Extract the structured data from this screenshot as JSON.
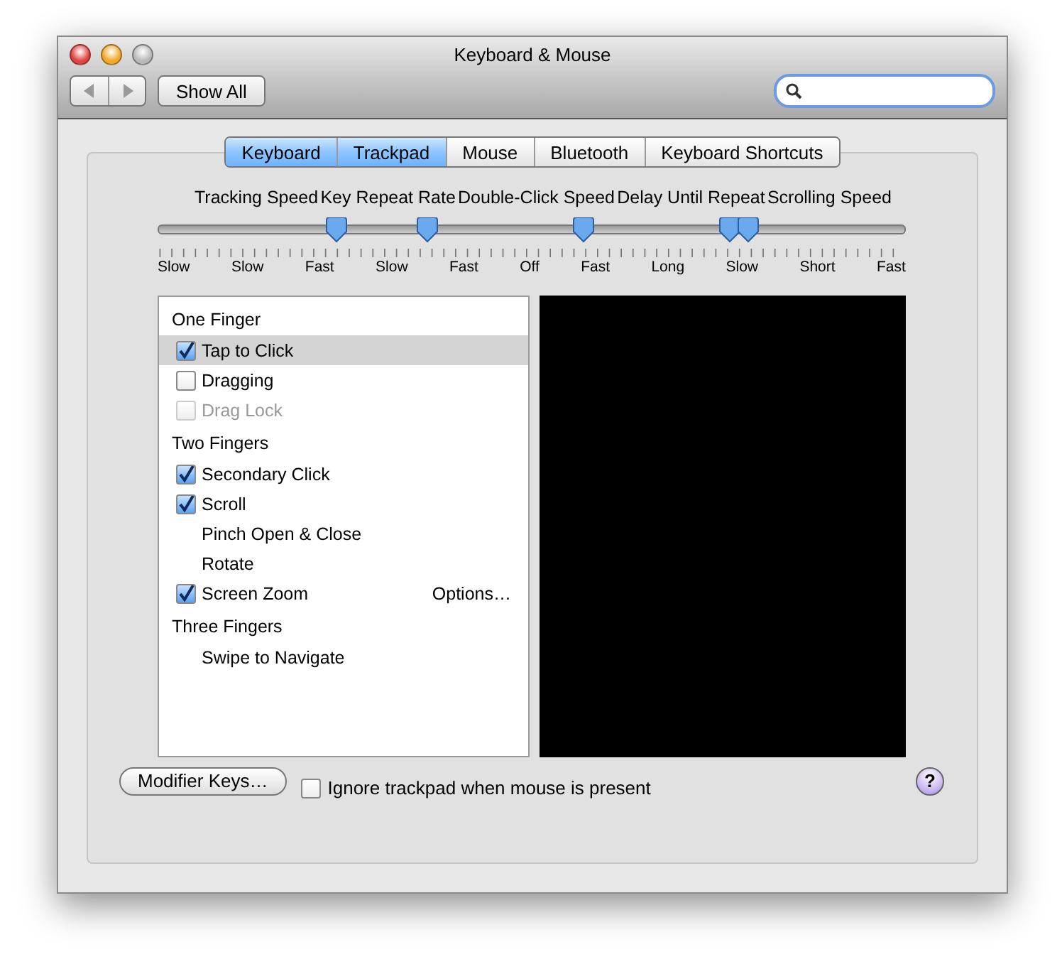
{
  "window": {
    "title": "Keyboard & Mouse"
  },
  "toolbar": {
    "show_all": "Show All"
  },
  "tabs": [
    {
      "label": "Keyboard",
      "selected": true
    },
    {
      "label": "Trackpad",
      "selected": true
    },
    {
      "label": "Mouse",
      "selected": false
    },
    {
      "label": "Bluetooth",
      "selected": false
    },
    {
      "label": "Keyboard Shortcuts",
      "selected": false
    }
  ],
  "sliders": {
    "headings": [
      "Tracking Speed",
      "Key Repeat Rate",
      "Double-Click Speed",
      "Delay Until Repeat",
      "Scrolling Speed"
    ],
    "thumbs": [
      {
        "level": 0.24
      },
      {
        "level": 0.36
      },
      {
        "level": 0.57
      },
      {
        "level": 0.765
      },
      {
        "level": 0.79
      }
    ],
    "tick_labels": [
      "Slow",
      "Slow",
      "Fast",
      "Slow",
      "Fast",
      "Off",
      "Fast",
      "Long",
      "Slow",
      "Short",
      "Fast"
    ]
  },
  "gesture_list": {
    "groups": [
      {
        "heading": "One Finger",
        "items": [
          {
            "label": "Tap to Click",
            "kind": "checkbox",
            "checked": true,
            "disabled": false,
            "selected": true
          },
          {
            "label": "Dragging",
            "kind": "checkbox",
            "checked": false,
            "disabled": false,
            "selected": false
          },
          {
            "label": "Drag Lock",
            "kind": "checkbox",
            "checked": false,
            "disabled": true,
            "selected": false
          }
        ]
      },
      {
        "heading": "Two Fingers",
        "items": [
          {
            "label": "Secondary Click",
            "kind": "checkbox",
            "checked": true,
            "disabled": false,
            "selected": false
          },
          {
            "label": "Scroll",
            "kind": "checkbox",
            "checked": true,
            "disabled": false,
            "selected": false
          },
          {
            "label": "Pinch Open & Close",
            "kind": "plain",
            "selected": false
          },
          {
            "label": "Rotate",
            "kind": "plain",
            "selected": false
          },
          {
            "label": "Screen Zoom",
            "kind": "checkbox",
            "checked": true,
            "disabled": false,
            "selected": false,
            "options": "Options…"
          }
        ]
      },
      {
        "heading": "Three Fingers",
        "items": [
          {
            "label": "Swipe to Navigate",
            "kind": "plain",
            "selected": false
          }
        ]
      }
    ]
  },
  "bottom": {
    "modifier_button": "Modifier Keys…",
    "ignore_checkbox": {
      "label": "Ignore trackpad when mouse is present",
      "checked": false
    },
    "help": "?"
  }
}
